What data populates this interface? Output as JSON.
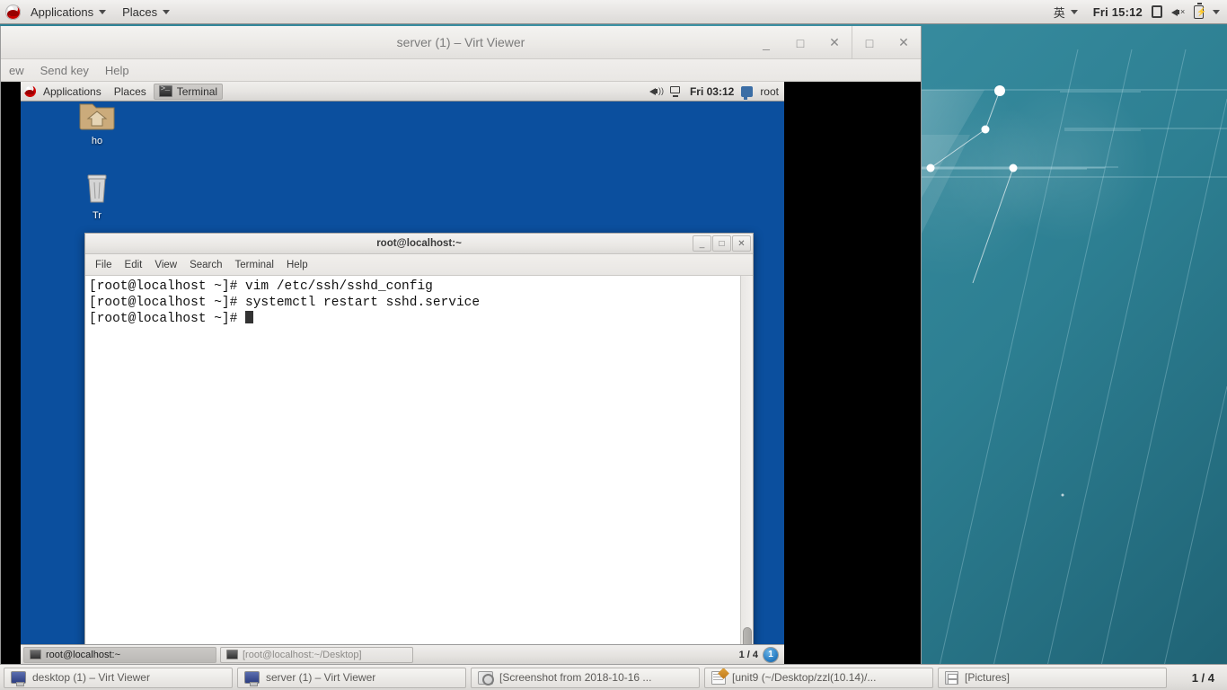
{
  "host": {
    "top_panel": {
      "applications_label": "Applications",
      "places_label": "Places",
      "ime_label": "英",
      "clock": "Fri 15:12",
      "logo_icon": "redhat-logo-icon",
      "screen_icon": "display-icon",
      "volume_icon": "volume-muted-icon",
      "battery_icon": "battery-charging-icon"
    },
    "taskbar": {
      "items": [
        {
          "label": "desktop (1) – Virt Viewer",
          "icon": "monitor-icon"
        },
        {
          "label": "server (1) – Virt Viewer",
          "icon": "monitor-icon"
        },
        {
          "label": "[Screenshot from 2018-10-16 ...",
          "icon": "screenshot-icon"
        },
        {
          "label": "[unit9 (~/Desktop/zzl(10.14)/...",
          "icon": "text-editor-icon"
        },
        {
          "label": "[Pictures]",
          "icon": "file-manager-icon"
        }
      ],
      "workspace": "1 / 4"
    }
  },
  "virt_viewer": {
    "title": "server (1) – Virt Viewer",
    "menus": [
      "ew",
      "Send key",
      "Help"
    ],
    "window_buttons": {
      "minimize": "_",
      "maximize": "□",
      "close": "✕"
    },
    "outer_buttons": {
      "restore": "□",
      "close": "✕"
    }
  },
  "guest": {
    "top_panel": {
      "applications_label": "Applications",
      "places_label": "Places",
      "active_window_label": "Terminal",
      "clock": "Fri 03:12",
      "user": "root",
      "volume_icon": "volume-icon",
      "network_icon": "network-disconnected-icon",
      "user_icon": "user-icon"
    },
    "desktop_icons": [
      {
        "label": "ho",
        "icon": "home-folder-icon"
      },
      {
        "label": "Tr",
        "icon": "trash-icon"
      }
    ],
    "terminal": {
      "title": "root@localhost:~",
      "menus": [
        "File",
        "Edit",
        "View",
        "Search",
        "Terminal",
        "Help"
      ],
      "buttons": {
        "minimize": "_",
        "maximize": "□",
        "close": "✕"
      },
      "lines": [
        "[root@localhost ~]# vim /etc/ssh/sshd_config",
        "[root@localhost ~]# systemctl restart sshd.service",
        "[root@localhost ~]# "
      ]
    },
    "taskbar": {
      "items": [
        {
          "label": "root@localhost:~",
          "state": "active"
        },
        {
          "label": "[root@localhost:~/Desktop]",
          "state": "inactive"
        }
      ],
      "workspace": "1 / 4",
      "workspace_number": "1"
    }
  },
  "colors": {
    "guest_desktop": "#0b4f9e",
    "host_wallpaper": "#2d7f92",
    "panel_bg": "#e7e5e3",
    "terminal_bg": "#ffffff",
    "terminal_fg": "#111111"
  }
}
